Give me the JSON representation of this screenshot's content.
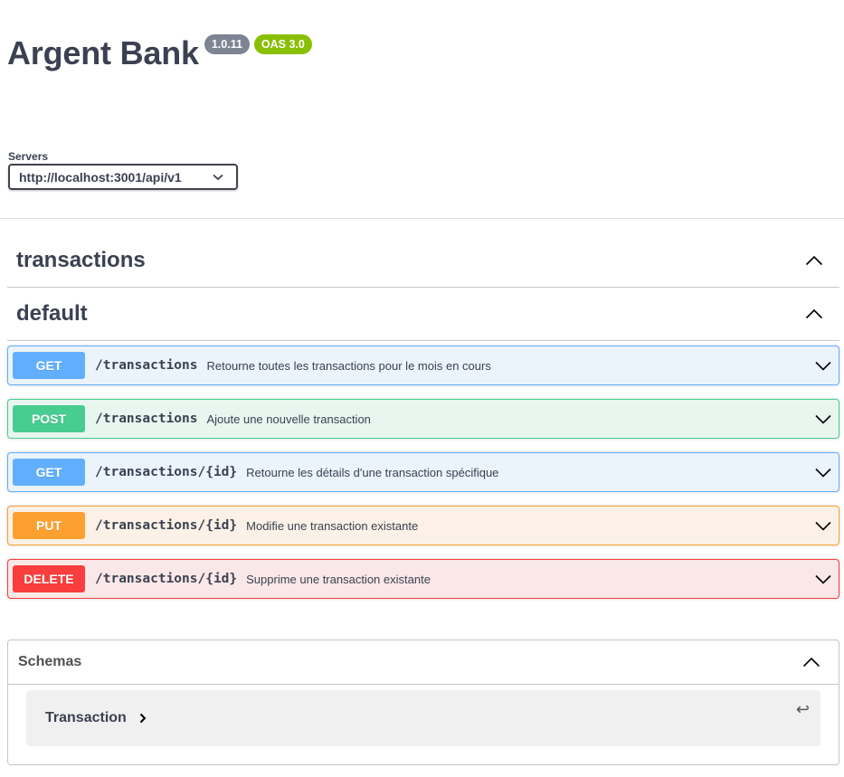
{
  "info": {
    "title": "Argent Bank",
    "version": "1.0.11",
    "oas": "OAS 3.0"
  },
  "servers": {
    "label": "Servers",
    "selected": "http://localhost:3001/api/v1"
  },
  "tags": [
    {
      "name": "transactions",
      "icon": "chevron-up-icon"
    },
    {
      "name": "default",
      "icon": "chevron-up-icon"
    }
  ],
  "operations": [
    {
      "method": "GET",
      "path": "/transactions",
      "summary": "Retourne toutes les transactions pour le mois en cours"
    },
    {
      "method": "POST",
      "path": "/transactions",
      "summary": "Ajoute une nouvelle transaction"
    },
    {
      "method": "GET",
      "path": "/transactions/{id}",
      "summary": "Retourne les détails d'une transaction spécifique"
    },
    {
      "method": "PUT",
      "path": "/transactions/{id}",
      "summary": "Modifie une transaction existante"
    },
    {
      "method": "DELETE",
      "path": "/transactions/{id}",
      "summary": "Supprime une transaction existante"
    }
  ],
  "schemas": {
    "title": "Schemas",
    "models": [
      {
        "name": "Transaction"
      }
    ]
  },
  "colors": {
    "get": "#61affe",
    "post": "#49cc90",
    "put": "#fca130",
    "delete": "#f93e3e",
    "text": "#3b4151"
  }
}
